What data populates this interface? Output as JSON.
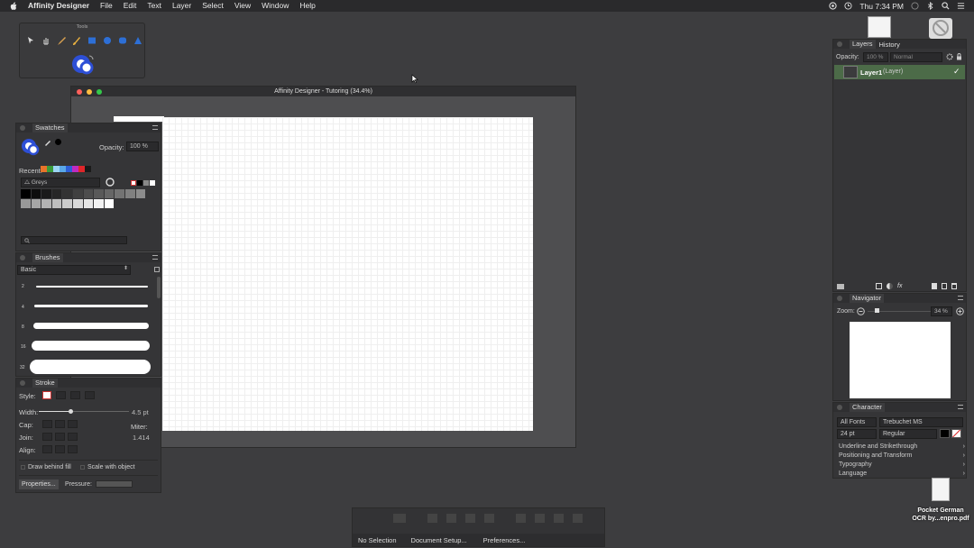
{
  "menubar": {
    "app": "Affinity Designer",
    "items": [
      "File",
      "Edit",
      "Text",
      "Layer",
      "Select",
      "View",
      "Window",
      "Help"
    ],
    "clock": "Thu 7:34 PM"
  },
  "tools": {
    "title": "Tools"
  },
  "document": {
    "title": "Affinity Designer - Tutoring (34.4%)"
  },
  "swatches": {
    "tab": "Swatches",
    "opacity_label": "Opacity:",
    "opacity_value": "100 %",
    "recent_label": "Recent:",
    "palette": "Greys",
    "recent_colors": [
      "#e8742a",
      "#3a9a3a",
      "#9cd4f4",
      "#5aa8e8",
      "#2d5fd6",
      "#c02ac0",
      "#e0262a",
      "#1a1a1a"
    ],
    "greys": [
      "#000000",
      "#0d0d0d",
      "#1a1a1a",
      "#262626",
      "#333333",
      "#404040",
      "#4d4d4d",
      "#595959",
      "#666666",
      "#737373",
      "#808080",
      "#8c8c8c",
      "#999999",
      "#a6a6a6",
      "#b3b3b3",
      "#bfbfbf",
      "#cccccc",
      "#d9d9d9",
      "#e6e6e6",
      "#f2f2f2",
      "#ffffff"
    ]
  },
  "brushes": {
    "tab": "Brushes",
    "category": "Basic",
    "sizes": [
      "2",
      "4",
      "8",
      "16",
      "32"
    ]
  },
  "stroke": {
    "tab": "Stroke",
    "style_label": "Style:",
    "width_label": "Width:",
    "width_value": "4.5 pt",
    "width_fraction": 0.35,
    "cap_label": "Cap:",
    "miter_label": "Miter:",
    "join_label": "Join:",
    "miter_value": "1.414",
    "align_label": "Align:",
    "draw_behind": "Draw behind fill",
    "scale_with": "Scale with object",
    "properties": "Properties...",
    "pressure": "Pressure:"
  },
  "layers": {
    "tab_layers": "Layers",
    "tab_history": "History",
    "opacity_label": "Opacity:",
    "opacity_value": "100 %",
    "blend": "Normal",
    "layer_name": "Layer1",
    "layer_type": "(Layer)"
  },
  "navigator": {
    "tab": "Navigator",
    "zoom_label": "Zoom:",
    "zoom_value": "34 %"
  },
  "character": {
    "tab": "Character",
    "collection": "All Fonts",
    "font": "Trebuchet MS",
    "size": "24 pt",
    "style": "Regular",
    "sections": [
      "Underline and Strikethrough",
      "Positioning and Transform",
      "Typography",
      "Language"
    ]
  },
  "desktop": {
    "file_label_line1": "Pocket German",
    "file_label_line2": "OCR by...enpro.pdf"
  },
  "contextbar": {
    "no_selection": "No Selection",
    "doc_setup": "Document Setup...",
    "preferences": "Preferences..."
  }
}
